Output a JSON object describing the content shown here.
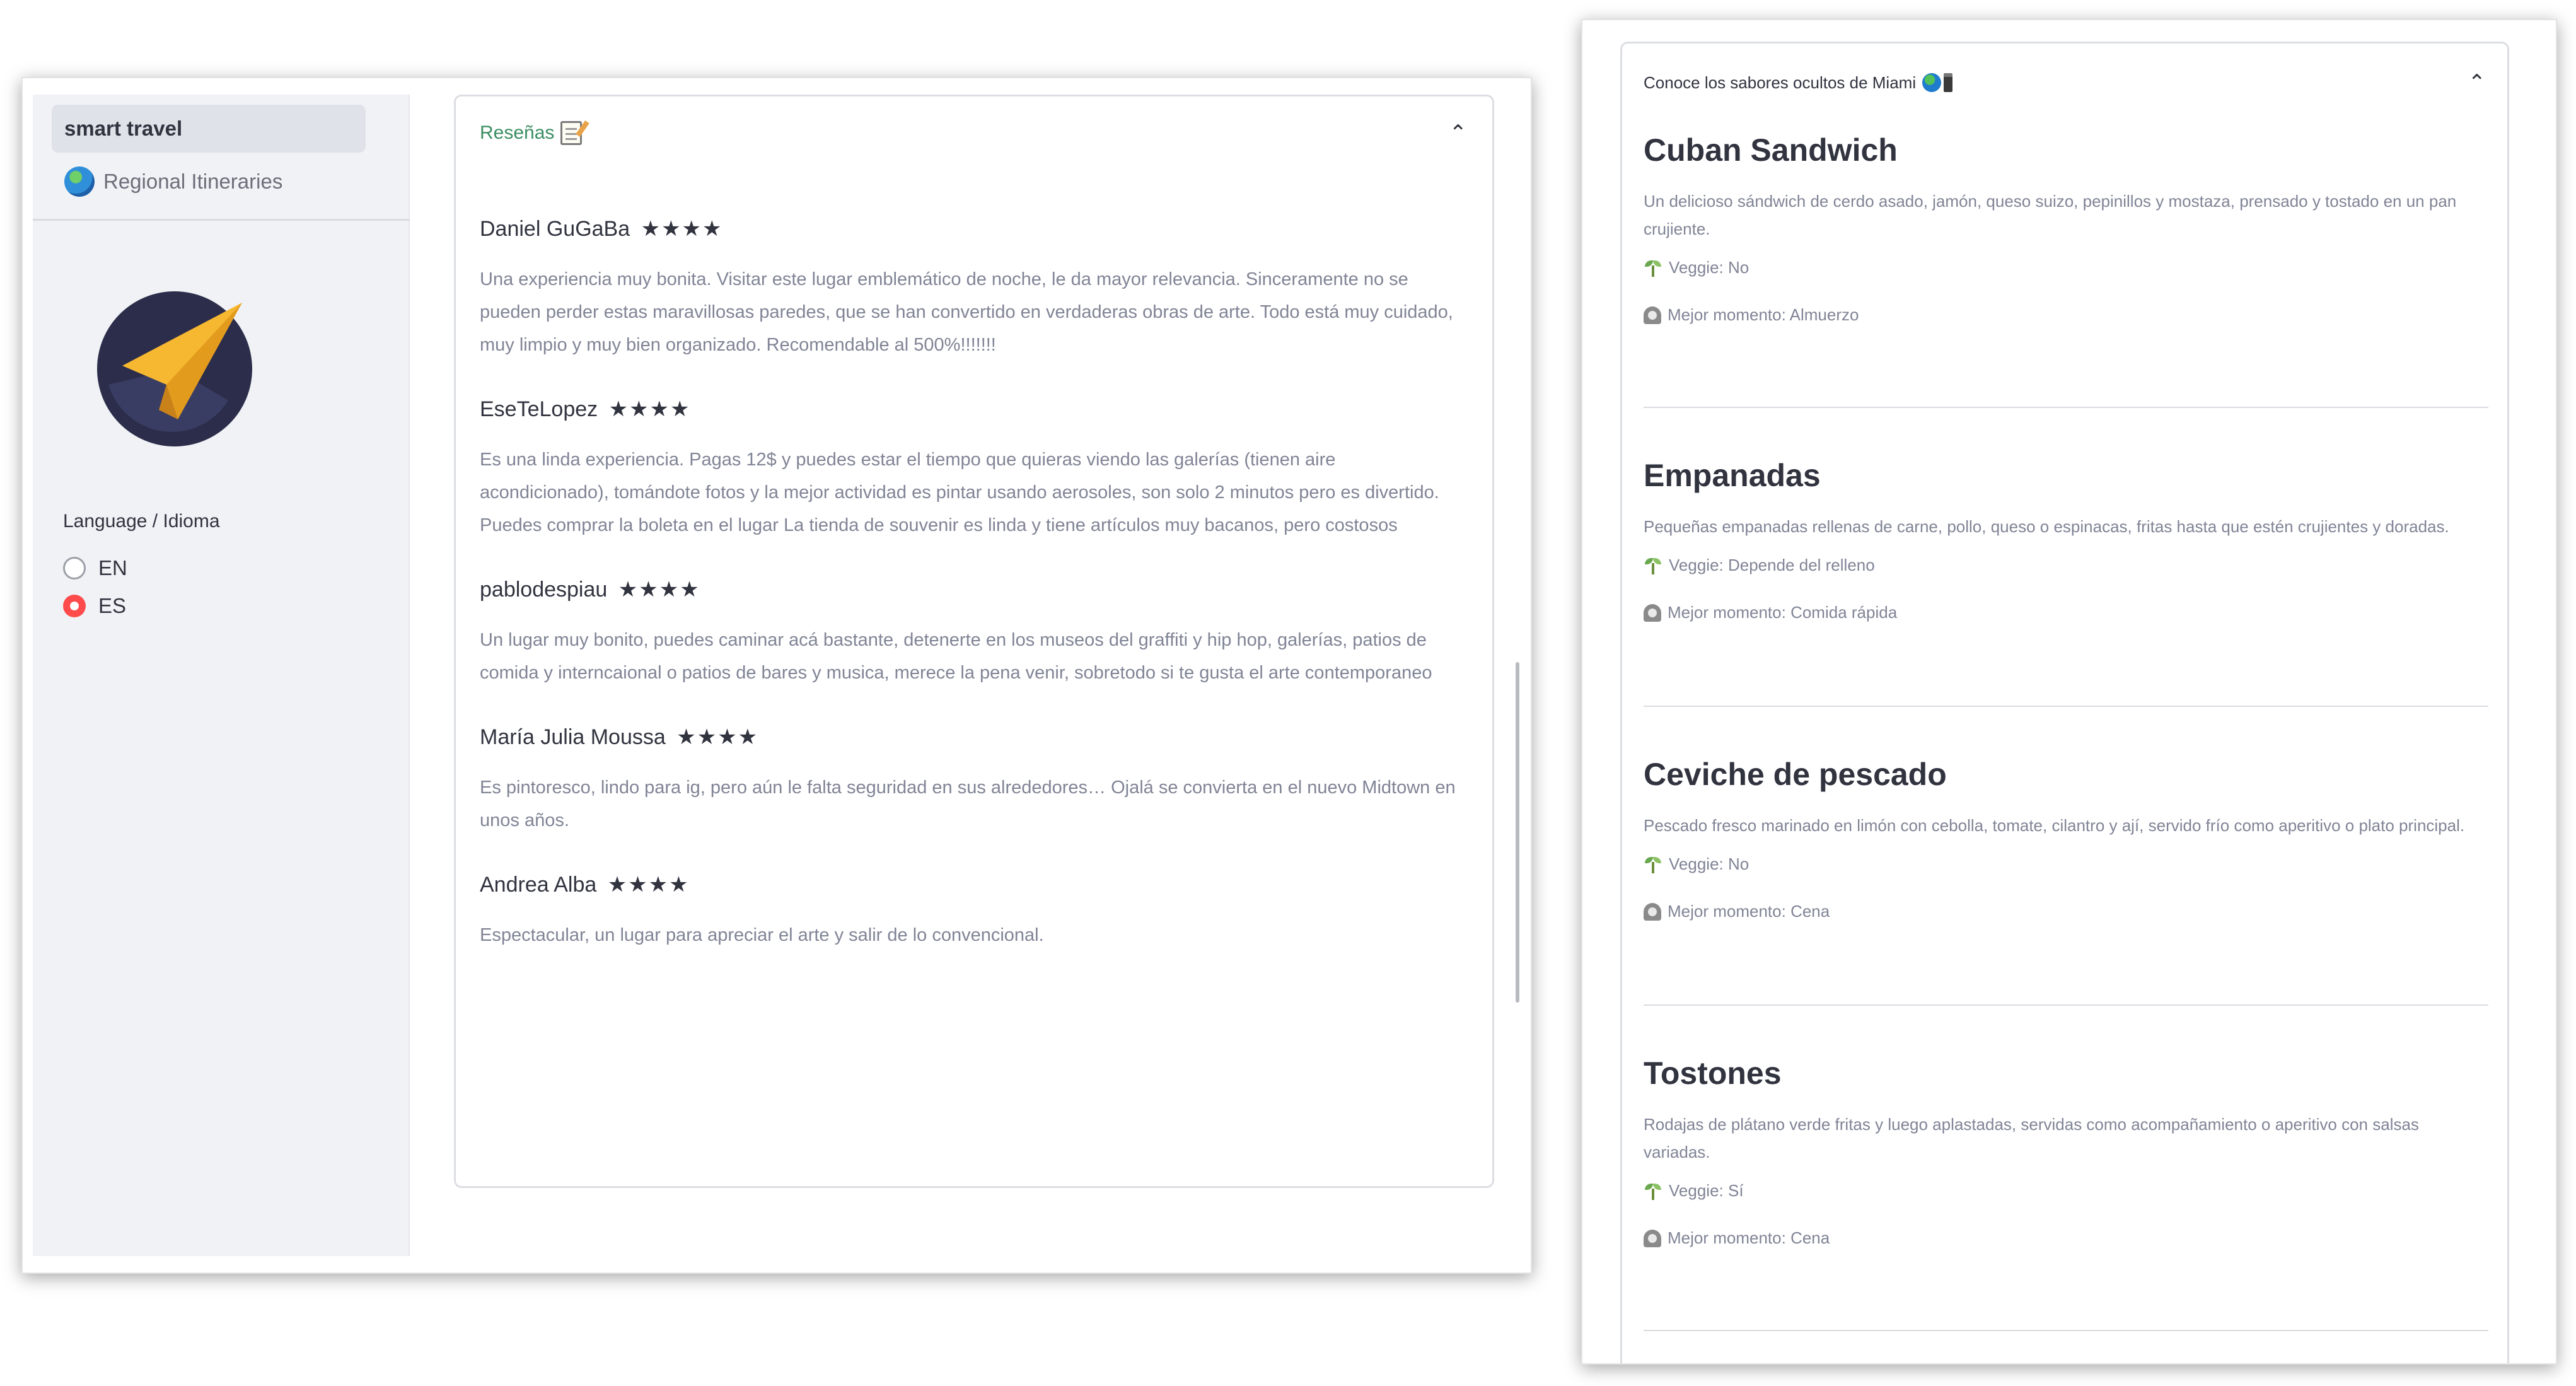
{
  "left_window": {
    "sidebar": {
      "nav_items": [
        {
          "label": "smart travel",
          "active": true
        },
        {
          "label": "Regional Itineraries",
          "active": false,
          "icon": "globe-icon"
        }
      ],
      "logo": "paper-plane-logo",
      "language_label": "Language / Idioma",
      "language_options": [
        "EN",
        "ES"
      ],
      "language_selected": "ES"
    },
    "reviews_expander": {
      "title": "Reseñas",
      "title_icon": "memo-icon",
      "expanded": true,
      "reviews": [
        {
          "author": "Daniel GuGaBa",
          "stars": "★★★★",
          "text": "Una experiencia muy bonita. Visitar este lugar emblemático de noche, le da mayor relevancia. Sinceramente no se pueden perder estas maravillosas paredes, que se han convertido en verdaderas obras de arte. Todo está muy cuidado, muy limpio y muy bien organizado. Recomendable al 500%!!!!!!!"
        },
        {
          "author": "EseTeLopez",
          "stars": "★★★★",
          "text": "Es una linda experiencia. Pagas 12$ y puedes estar el tiempo que quieras viendo las galerías (tienen aire acondicionado), tomándote fotos y la mejor actividad es pintar usando aerosoles, son solo 2 minutos pero es divertido. Puedes comprar la boleta en el lugar La tienda de souvenir es linda y tiene artículos muy bacanos, pero costosos"
        },
        {
          "author": "pablodespiau",
          "stars": "★★★★",
          "text": "Un lugar muy bonito, puedes caminar acá bastante, detenerte en los museos del graffiti y hip hop, galerías, patios de comida y interncaional o patios de bares y musica, merece la pena venir, sobretodo si te gusta el arte contemporaneo"
        },
        {
          "author": "María Julia Moussa",
          "stars": "★★★★",
          "text": "Es pintoresco, lindo para ig, pero aún le falta seguridad en sus alrededores… Ojalá se convierta en el nuevo Midtown en unos años."
        },
        {
          "author": "Andrea Alba",
          "stars": "★★★★",
          "text": "Espectacular, un lugar para apreciar el arte y salir de lo convencional."
        }
      ]
    }
  },
  "right_window": {
    "expander": {
      "title": "Conoce los sabores ocultos de Miami",
      "expanded": true,
      "dishes": [
        {
          "name": "Cuban Sandwich",
          "description": "Un delicioso sándwich de cerdo asado, jamón, queso suizo, pepinillos y mostaza, prensado y tostado en un pan crujiente.",
          "veggie": "Veggie: No",
          "best_time": "Mejor momento: Almuerzo"
        },
        {
          "name": "Empanadas",
          "description": "Pequeñas empanadas rellenas de carne, pollo, queso o espinacas, fritas hasta que estén crujientes y doradas.",
          "veggie": "Veggie: Depende del relleno",
          "best_time": "Mejor momento: Comida rápida"
        },
        {
          "name": "Ceviche de pescado",
          "description": "Pescado fresco marinado en limón con cebolla, tomate, cilantro y ají, servido frío como aperitivo o plato principal.",
          "veggie": "Veggie: No",
          "best_time": "Mejor momento: Cena"
        },
        {
          "name": "Tostones",
          "description": "Rodajas de plátano verde fritas y luego aplastadas, servidas como acompañamiento o aperitivo con salsas variadas.",
          "veggie": "Veggie: Sí",
          "best_time": "Mejor momento: Cena"
        }
      ]
    }
  },
  "colors": {
    "accent_radio": "#ff4b4b",
    "expander_title_green": "#3b8e63",
    "sidebar_bg": "#f0f2f6",
    "muted_text": "#808495"
  }
}
